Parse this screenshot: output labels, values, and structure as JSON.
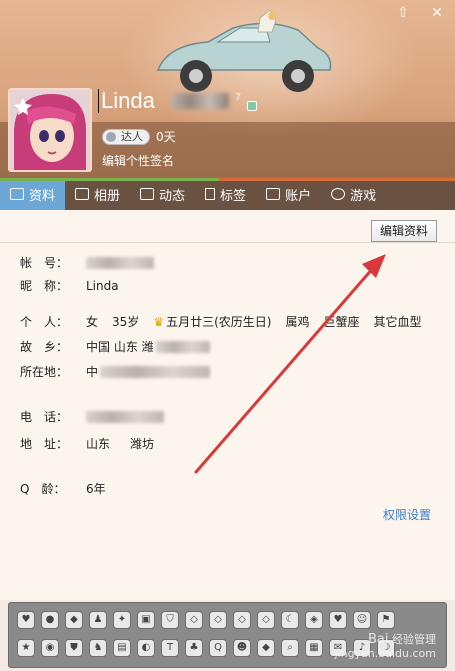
{
  "profile": {
    "name": "Linda",
    "name_suffix": "7",
    "level_badge": "达人",
    "level_days": "0天",
    "signature_placeholder": "编辑个性签名"
  },
  "tabs": [
    {
      "label": "资料",
      "icon": "profile-card-icon",
      "active": true
    },
    {
      "label": "相册",
      "icon": "photo-icon",
      "active": false
    },
    {
      "label": "动态",
      "icon": "feed-list-icon",
      "active": false
    },
    {
      "label": "标签",
      "icon": "bookmark-icon",
      "active": false
    },
    {
      "label": "账户",
      "icon": "wallet-icon",
      "active": false
    },
    {
      "label": "游戏",
      "icon": "game-icon",
      "active": false
    }
  ],
  "actions": {
    "edit_profile": "编辑资料",
    "permission_settings": "权限设置"
  },
  "fields": {
    "account": {
      "label": "帐　号："
    },
    "nickname": {
      "label": "昵　称：",
      "value": "Linda"
    },
    "personal": {
      "label": "个　人：",
      "gender": "女",
      "age": "35岁",
      "birthday": "五月廿三(农历生日)",
      "zodiac": "属鸡",
      "constellation": "巨蟹座",
      "blood_type": "其它血型"
    },
    "hometown": {
      "label": "故　乡：",
      "value": "中国 山东 潍"
    },
    "location": {
      "label": "所在地：",
      "value": "中"
    },
    "phone": {
      "label": "电　话："
    },
    "address": {
      "label": "地　址：",
      "province": "山东",
      "city": "潍坊"
    },
    "q_age": {
      "label": "Q　龄：",
      "value": "6年"
    }
  },
  "watermark": {
    "line1": "Bai",
    "line2": "经验管理",
    "line3": "jingyan.baidu.com"
  },
  "colors": {
    "active_tab": "#6da7d7",
    "link": "#3a7fc4",
    "arrow": "#d9393a"
  }
}
